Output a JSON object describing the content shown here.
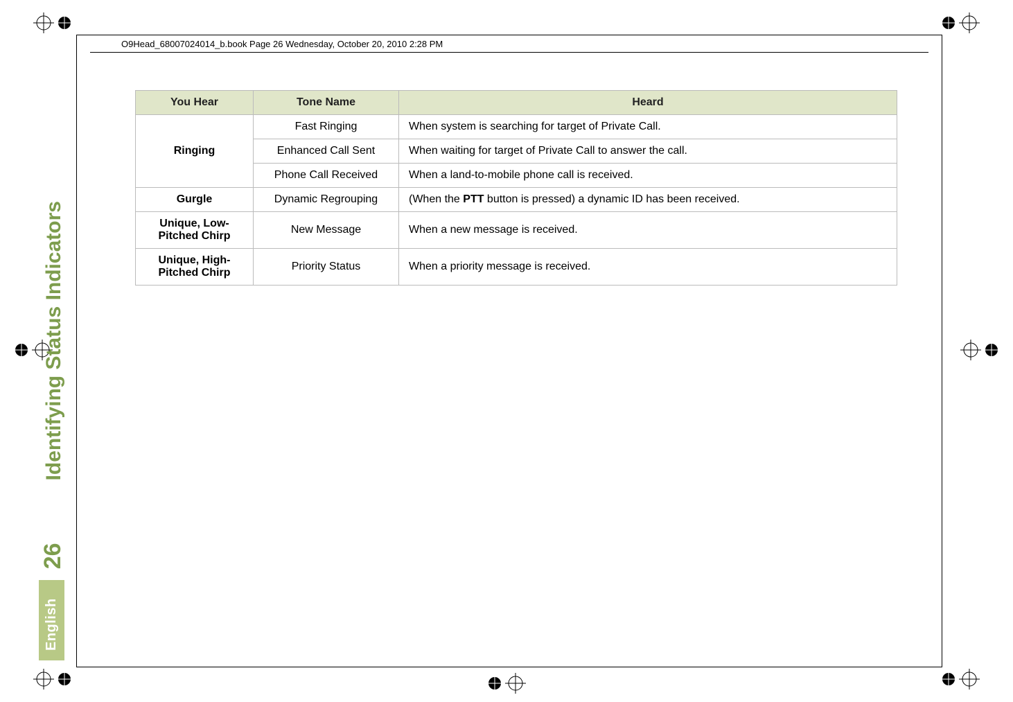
{
  "masthead": "O9Head_68007024014_b.book  Page 26  Wednesday, October 20, 2010  2:28 PM",
  "sidebar": {
    "english": "English",
    "page_number": "26",
    "section_title": "Identifying Status Indicators"
  },
  "table": {
    "headers": {
      "c1": "You Hear",
      "c2": "Tone Name",
      "c3": "Heard"
    },
    "rows": [
      {
        "c1": "Ringing",
        "c1_rowspan": 3,
        "c2": "Fast Ringing",
        "c3": "When system is searching for target of Private Call."
      },
      {
        "c2": "Enhanced Call Sent",
        "c3": "When waiting for target of Private Call to answer the call."
      },
      {
        "c2": "Phone Call Received",
        "c3": "When a land-to-mobile phone call is received."
      },
      {
        "c1": "Gurgle",
        "c2": "Dynamic Regrouping",
        "c3_pre": "(When the ",
        "c3_bold": "PTT",
        "c3_post": " button is pressed) a dynamic ID has been received."
      },
      {
        "c1": "Unique, Low-Pitched Chirp",
        "c2": "New Message",
        "c3": "When a new message is received."
      },
      {
        "c1": "Unique, High-Pitched Chirp",
        "c2": "Priority Status",
        "c3": "When a priority message is received."
      }
    ]
  }
}
